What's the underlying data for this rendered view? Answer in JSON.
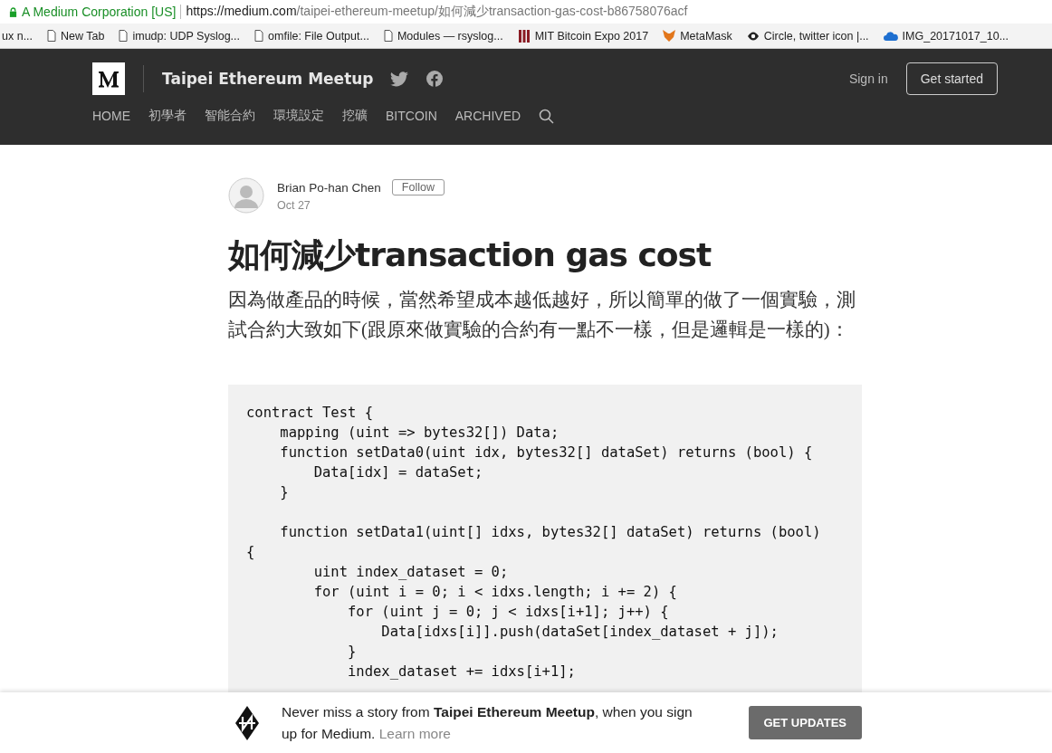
{
  "browser": {
    "secure_label": "A Medium Corporation [US]",
    "url_host": "https://medium.com",
    "url_path": "/taipei-ethereum-meetup/如何減少transaction-gas-cost-b86758076acf"
  },
  "bookmarks": [
    {
      "label": "ux n...",
      "kind": "none"
    },
    {
      "label": "New Tab",
      "kind": "page"
    },
    {
      "label": "imudp: UDP Syslog...",
      "kind": "page"
    },
    {
      "label": "omfile: File Output...",
      "kind": "page"
    },
    {
      "label": "Modules — rsyslog...",
      "kind": "page"
    },
    {
      "label": "MIT Bitcoin Expo 2017",
      "kind": "bars"
    },
    {
      "label": "MetaMask",
      "kind": "fox"
    },
    {
      "label": "Circle, twitter icon |...",
      "kind": "eye"
    },
    {
      "label": "IMG_20171017_10...",
      "kind": "cloud"
    }
  ],
  "header": {
    "publication": "Taipei Ethereum Meetup",
    "sign_in": "Sign in",
    "get_started": "Get started",
    "nav": [
      "HOME",
      "初學者",
      "智能合約",
      "環境設定",
      "挖礦",
      "BITCOIN",
      "ARCHIVED"
    ]
  },
  "author": {
    "name": "Brian Po-han Chen",
    "follow": "Follow",
    "date": "Oct 27"
  },
  "article": {
    "title": "如何減少transaction gas cost",
    "paragraph": "因為做產品的時候，當然希望成本越低越好，所以簡單的做了一個實驗，測試合約大致如下(跟原來做實驗的合約有一點不一樣，但是邏輯是一樣的)：",
    "code": "contract Test {\n    mapping (uint => bytes32[]) Data;\n    function setData0(uint idx, bytes32[] dataSet) returns (bool) {\n        Data[idx] = dataSet;\n    }\n\n    function setData1(uint[] idxs, bytes32[] dataSet) returns (bool)\n{\n        uint index_dataset = 0;\n        for (uint i = 0; i < idxs.length; i += 2) {\n            for (uint j = 0; j < idxs[i+1]; j++) {\n                Data[idxs[i]].push(dataSet[index_dataset + j]);\n            }\n            index_dataset += idxs[i+1];"
  },
  "banner": {
    "text": "Never miss a story from **Taipei Ethereum Meetup**, when you sign up for Medium.",
    "link": "Learn more",
    "button": "GET UPDATES"
  }
}
